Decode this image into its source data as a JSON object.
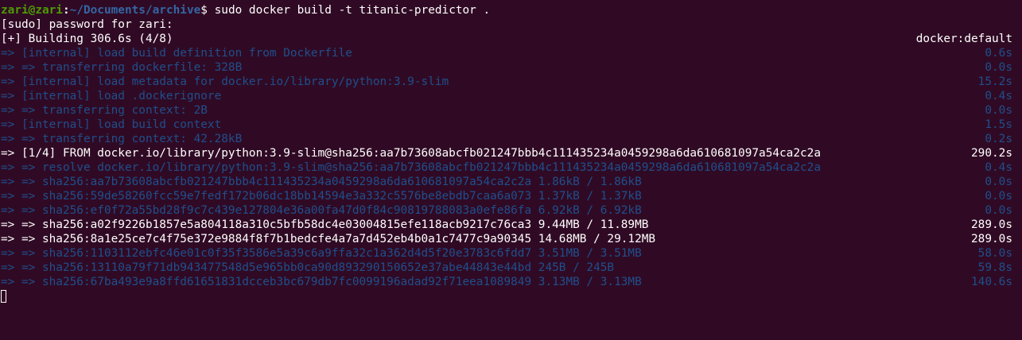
{
  "prompt": {
    "user_host": "zari@zari",
    "colon": ":",
    "path": "~/Documents/archive",
    "symbol": "$",
    "command": " sudo docker build -t titanic-predictor ."
  },
  "sudo_line": "[sudo] password for zari:",
  "building": {
    "text": "[+] Building 306.6s (4/8)",
    "right": "docker:default"
  },
  "lines": [
    {
      "text": "=> [internal] load build definition from Dockerfile",
      "time": "0.6s",
      "style": "dim"
    },
    {
      "text": "=> => transferring dockerfile: 328B",
      "time": "0.0s",
      "style": "dim"
    },
    {
      "text": "=> [internal] load metadata for docker.io/library/python:3.9-slim",
      "time": "15.2s",
      "style": "dim"
    },
    {
      "text": "=> [internal] load .dockerignore",
      "time": "0.4s",
      "style": "dim"
    },
    {
      "text": "=> => transferring context: 2B",
      "time": "0.0s",
      "style": "dim"
    },
    {
      "text": "=> [internal] load build context",
      "time": "1.5s",
      "style": "dim"
    },
    {
      "text": "=> => transferring context: 42.28kB",
      "time": "0.2s",
      "style": "dim"
    },
    {
      "text": "=> [1/4] FROM docker.io/library/python:3.9-slim@sha256:aa7b73608abcfb021247bbb4c111435234a0459298a6da610681097a54ca2c2a",
      "time": "290.2s",
      "style": "bright"
    },
    {
      "text": "=> => resolve docker.io/library/python:3.9-slim@sha256:aa7b73608abcfb021247bbb4c111435234a0459298a6da610681097a54ca2c2a",
      "time": "0.4s",
      "style": "dim"
    },
    {
      "text": "=> => sha256:aa7b73608abcfb021247bbb4c111435234a0459298a6da610681097a54ca2c2a 1.86kB / 1.86kB",
      "time": "0.0s",
      "style": "dim"
    },
    {
      "text": "=> => sha256:59de58260fcc59e7fedf172b06dc18bb14594e3a332c5576be8ebdb7caa6a073 1.37kB / 1.37kB",
      "time": "0.0s",
      "style": "dim"
    },
    {
      "text": "=> => sha256:ef0f72a55bd28f9c7c439e127804e36a00fa47d0f84c90819788083a0efe86fa 6.92kB / 6.92kB",
      "time": "0.0s",
      "style": "dim"
    },
    {
      "text": "=> => sha256:a02f9226b1857e5a804118a310c5bfb58dc4e03004815efe118acb9217c76ca3 9.44MB / 11.89MB",
      "time": "289.0s",
      "style": "bright"
    },
    {
      "text": "=> => sha256:8a1e25ce7c4f75e372e9884f8f7b1bedcfe4a7a7d452eb4b0a1c7477c9a90345 14.68MB / 29.12MB",
      "time": "289.0s",
      "style": "bright"
    },
    {
      "text": "=> => sha256:1103112ebfc46e01c0f35f3586e5a39c6a9ffa32c1a362d4d5f20e3783c6fdd7 3.51MB / 3.51MB",
      "time": "58.0s",
      "style": "dim"
    },
    {
      "text": "=> => sha256:13110a79f71db943477548d5e965bb0ca90d893290150652e37abe44843e44bd 245B / 245B",
      "time": "59.8s",
      "style": "dim"
    },
    {
      "text": "=> => sha256:67ba493e9a8ffd61651831dcceb3bc679db7fc0099196adad92f71eea1089849 3.13MB / 3.13MB",
      "time": "140.6s",
      "style": "dim"
    }
  ],
  "colors": {
    "background": "#300a24",
    "bright_text": "#ffffff",
    "dim_text": "#1f4f8c",
    "prompt_user": "#4e9a06",
    "prompt_path": "#3465a4"
  }
}
